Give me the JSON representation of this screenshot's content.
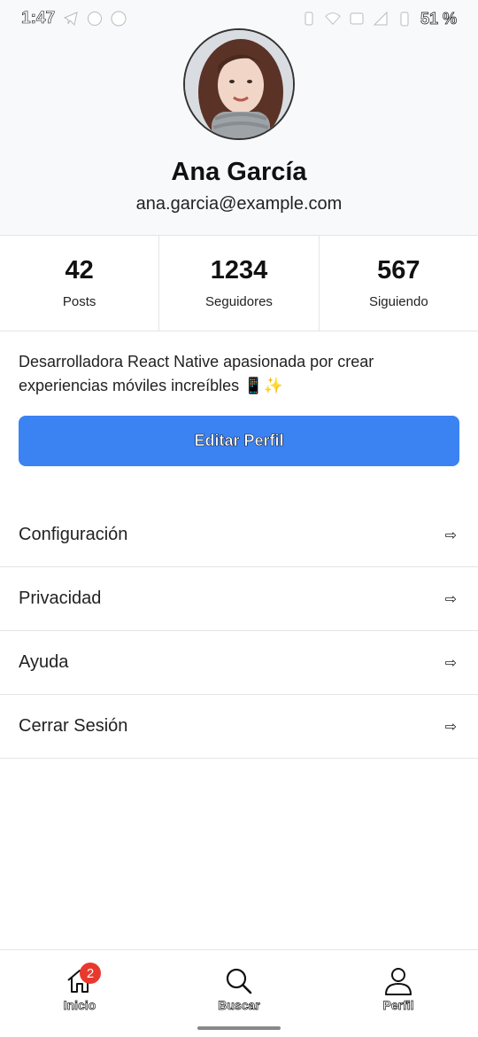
{
  "status_bar": {
    "time": "1:47",
    "battery": "51 %",
    "left_icons": [
      "telegram-icon",
      "whatsapp-icon",
      "messenger-icon"
    ],
    "right_icons": [
      "vibrate-icon",
      "wifi-icon",
      "data-icon",
      "signal-icon",
      "battery-icon"
    ]
  },
  "profile": {
    "name": "Ana García",
    "email": "ana.garcia@example.com",
    "avatar_icon": "avatar-photo"
  },
  "stats": [
    {
      "value": "42",
      "label": "Posts"
    },
    {
      "value": "1234",
      "label": "Seguidores"
    },
    {
      "value": "567",
      "label": "Siguiendo"
    }
  ],
  "bio": "Desarrolladora React Native apasionada por crear experiencias móviles increíbles 📱✨",
  "edit_button": {
    "label": "Editar Perfil",
    "color": "#3b82f3"
  },
  "menu": [
    {
      "label": "Configuración",
      "arrow": "⇨"
    },
    {
      "label": "Privacidad",
      "arrow": "⇨"
    },
    {
      "label": "Ayuda",
      "arrow": "⇨"
    },
    {
      "label": "Cerrar Sesión",
      "arrow": "⇨"
    }
  ],
  "bottom_nav": {
    "items": [
      {
        "label": "Inicio",
        "icon": "home-icon",
        "badge": "2"
      },
      {
        "label": "Buscar",
        "icon": "search-icon"
      },
      {
        "label": "Perfil",
        "icon": "user-icon"
      }
    ],
    "badge_color": "#e8392e"
  }
}
